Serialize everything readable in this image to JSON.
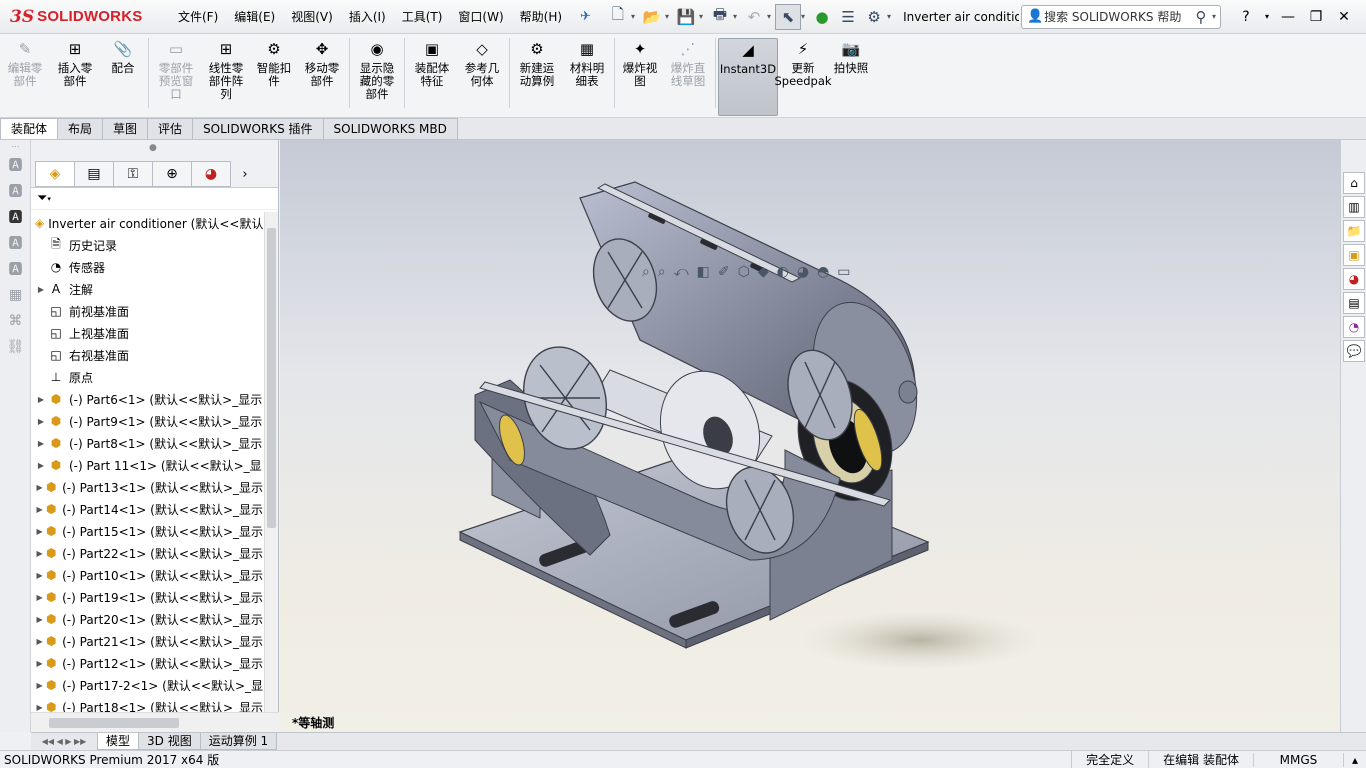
{
  "app": {
    "logo_ds": "3S",
    "logo_name": "SOLIDWORKS",
    "document_title": "Inverter air conditio..."
  },
  "menus": [
    "文件(F)",
    "编辑(E)",
    "视图(V)",
    "插入(I)",
    "工具(T)",
    "窗口(W)",
    "帮助(H)"
  ],
  "search": {
    "placeholder": "搜索 SOLIDWORKS 帮助"
  },
  "command_manager": {
    "buttons": [
      {
        "label": "编辑零部件",
        "icon": "edit-component-icon",
        "disabled": true
      },
      {
        "label": "插入零部件",
        "icon": "insert-components-icon",
        "disabled": false
      },
      {
        "label": "配合",
        "icon": "mate-icon",
        "disabled": false
      },
      {
        "label": "零部件预览窗口",
        "icon": "component-preview-icon",
        "disabled": true
      },
      {
        "label": "线性零部件阵列",
        "icon": "linear-pattern-icon",
        "disabled": false
      },
      {
        "label": "智能扣件",
        "icon": "smart-fasteners-icon",
        "disabled": false
      },
      {
        "label": "移动零部件",
        "icon": "move-component-icon",
        "disabled": false
      },
      {
        "label": "显示隐藏的零部件",
        "icon": "show-hidden-icon",
        "disabled": false
      },
      {
        "label": "装配体特征",
        "icon": "assembly-features-icon",
        "disabled": false
      },
      {
        "label": "参考几何体",
        "icon": "reference-geometry-icon",
        "disabled": false
      },
      {
        "label": "新建运动算例",
        "icon": "new-motion-study-icon",
        "disabled": false
      },
      {
        "label": "材料明细表",
        "icon": "bill-of-materials-icon",
        "disabled": false
      },
      {
        "label": "爆炸视图",
        "icon": "exploded-view-icon",
        "disabled": false
      },
      {
        "label": "爆炸直线草图",
        "icon": "explode-line-sketch-icon",
        "disabled": true
      },
      {
        "label": "Instant3D",
        "icon": "instant3d-icon",
        "disabled": false,
        "active": true
      },
      {
        "label": "更新Speedpak",
        "icon": "update-speedpak-icon",
        "disabled": false
      },
      {
        "label": "拍快照",
        "icon": "take-snapshot-icon",
        "disabled": false
      }
    ]
  },
  "command_tabs": [
    "装配体",
    "布局",
    "草图",
    "评估",
    "SOLIDWORKS 插件",
    "SOLIDWORKS MBD"
  ],
  "feature_tree": {
    "root": "Inverter air conditioner (默认<<默认",
    "items": [
      {
        "label": "历史记录",
        "expandable": false
      },
      {
        "label": "传感器",
        "expandable": false
      },
      {
        "label": "注解",
        "expandable": true
      },
      {
        "label": "前视基准面",
        "expandable": false
      },
      {
        "label": "上视基准面",
        "expandable": false
      },
      {
        "label": "右视基准面",
        "expandable": false
      },
      {
        "label": "原点",
        "expandable": false
      },
      {
        "label": "(-) Part6<1> (默认<<默认>_显示",
        "expandable": true
      },
      {
        "label": "(-) Part9<1> (默认<<默认>_显示",
        "expandable": true
      },
      {
        "label": "(-) Part8<1> (默认<<默认>_显示",
        "expandable": true
      },
      {
        "label": "(-) Part 11<1> (默认<<默认>_显",
        "expandable": true
      },
      {
        "label": "(-) Part13<1> (默认<<默认>_显示",
        "expandable": true
      },
      {
        "label": "(-) Part14<1> (默认<<默认>_显示",
        "expandable": true
      },
      {
        "label": "(-) Part15<1> (默认<<默认>_显示",
        "expandable": true
      },
      {
        "label": "(-) Part22<1> (默认<<默认>_显示",
        "expandable": true
      },
      {
        "label": "(-) Part10<1> (默认<<默认>_显示",
        "expandable": true
      },
      {
        "label": "(-) Part19<1> (默认<<默认>_显示",
        "expandable": true
      },
      {
        "label": "(-) Part20<1> (默认<<默认>_显示",
        "expandable": true
      },
      {
        "label": "(-) Part21<1> (默认<<默认>_显示",
        "expandable": true
      },
      {
        "label": "(-) Part12<1> (默认<<默认>_显示",
        "expandable": true
      },
      {
        "label": "(-) Part17-2<1> (默认<<默认>_显",
        "expandable": true
      },
      {
        "label": "(-) Part18<1> (默认<<默认>_显示",
        "expandable": true
      }
    ]
  },
  "viewport": {
    "view_label": "*等轴测"
  },
  "bottom_tabs": [
    "模型",
    "3D 视图",
    "运动算例 1"
  ],
  "status": {
    "product": "SOLIDWORKS Premium 2017 x64 版",
    "definition": "完全定义",
    "editing": "在编辑 装配体",
    "units": "MMGS"
  }
}
